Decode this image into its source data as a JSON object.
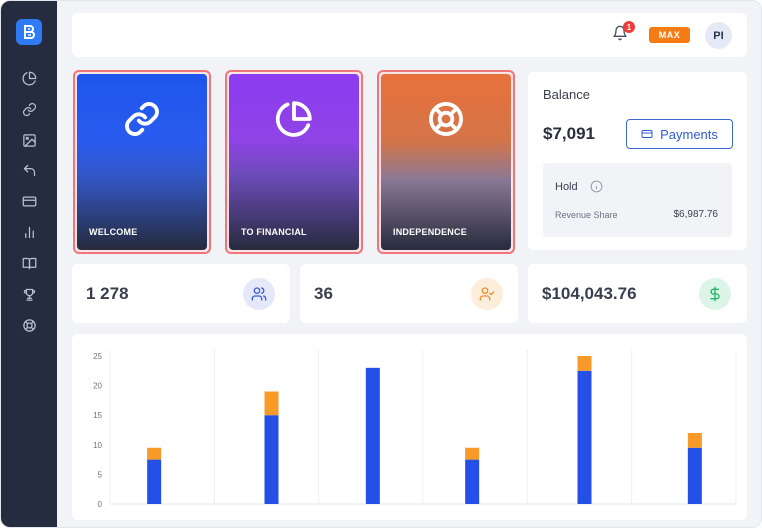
{
  "header": {
    "notification_count": "1",
    "plan_badge": "MAX",
    "avatar_initials": "PI"
  },
  "sidebar": {
    "logo_icon": "logo-b-icon",
    "items": [
      {
        "icon": "pie-chart-icon"
      },
      {
        "icon": "link-icon"
      },
      {
        "icon": "image-icon"
      },
      {
        "icon": "undo-arrow-icon"
      },
      {
        "icon": "credit-card-icon"
      },
      {
        "icon": "bar-chart-icon"
      },
      {
        "icon": "book-icon"
      },
      {
        "icon": "trophy-icon"
      },
      {
        "icon": "lifebuoy-icon"
      }
    ]
  },
  "cards": [
    {
      "label": "WELCOME",
      "icon": "link-icon",
      "color_top": "#1d56ec"
    },
    {
      "label": "TO FINANCIAL",
      "icon": "pie-chart-icon",
      "color_top": "#8b3cf0"
    },
    {
      "label": "INDEPENDENCE",
      "icon": "lifebuoy-icon",
      "color_top": "#e8713b"
    }
  ],
  "balance": {
    "title": "Balance",
    "amount": "$7,091",
    "payments_button": "Payments",
    "hold_title": "Hold",
    "revenue_label": "Revenue Share",
    "revenue_value": "$6,987.76"
  },
  "stats": [
    {
      "value": "1 278",
      "icon": "users-icon",
      "color": "#3e5bd6"
    },
    {
      "value": "36",
      "icon": "user-check-icon",
      "color": "#f08c2a"
    },
    {
      "value": "$104,043.76",
      "icon": "dollar-icon",
      "color": "#1fb46a"
    }
  ],
  "chart_data": {
    "type": "bar",
    "stacked": true,
    "categories": [
      "",
      "",
      "",
      "",
      "",
      ""
    ],
    "ylim": [
      0,
      25
    ],
    "yticks": [
      "0",
      "5",
      "10",
      "15",
      "20",
      "25"
    ],
    "grid": "vertical",
    "series": [
      {
        "color": "#2450e8",
        "values": [
          7.5,
          15,
          23,
          7.5,
          22.5,
          9.5
        ]
      },
      {
        "color": "#f79a28",
        "values": [
          2,
          4,
          0,
          2,
          2.5,
          2.5
        ]
      }
    ]
  }
}
